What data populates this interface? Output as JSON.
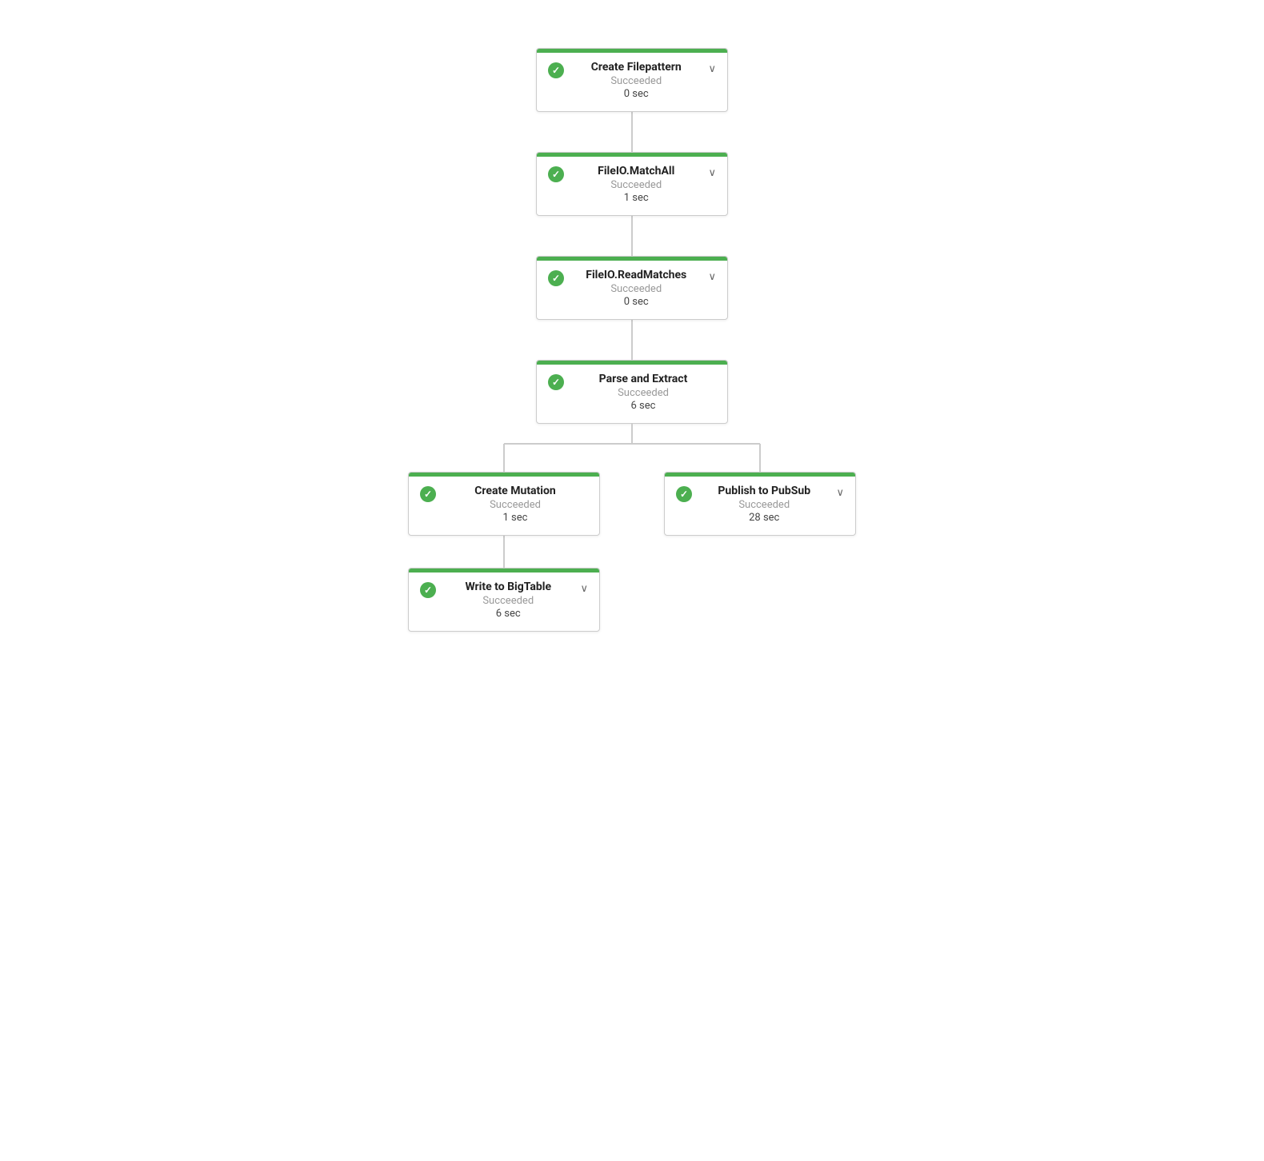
{
  "nodes": {
    "create_filepattern": {
      "title": "Create Filepattern",
      "status": "Succeeded",
      "time": "0 sec",
      "has_chevron": true
    },
    "fileio_matchall": {
      "title": "FileIO.MatchAll",
      "status": "Succeeded",
      "time": "1 sec",
      "has_chevron": true
    },
    "fileio_readmatches": {
      "title": "FileIO.ReadMatches",
      "status": "Succeeded",
      "time": "0 sec",
      "has_chevron": true
    },
    "parse_and_extract": {
      "title": "Parse and Extract",
      "status": "Succeeded",
      "time": "6 sec",
      "has_chevron": false
    },
    "create_mutation": {
      "title": "Create Mutation",
      "status": "Succeeded",
      "time": "1 sec",
      "has_chevron": false
    },
    "publish_to_pubsub": {
      "title": "Publish to PubSub",
      "status": "Succeeded",
      "time": "28 sec",
      "has_chevron": true
    },
    "write_to_bigtable": {
      "title": "Write to BigTable",
      "status": "Succeeded",
      "time": "6 sec",
      "has_chevron": true
    }
  },
  "connector": {
    "color": "#cccccc"
  }
}
